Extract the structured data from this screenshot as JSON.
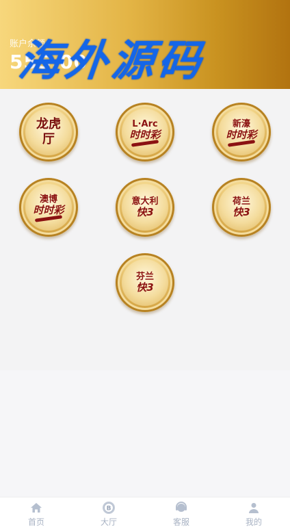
{
  "header": {
    "balance_label": "账户余额",
    "balance_value": "555.00",
    "watermark": "海外源码"
  },
  "games": [
    {
      "top": "龙虎",
      "bottom": "厅",
      "style": "single"
    },
    {
      "top": "L·Arc",
      "bottom": "时时彩",
      "style": "ssc"
    },
    {
      "top": "新濠",
      "bottom": "时时彩",
      "style": "ssc"
    },
    {
      "top": "澳博",
      "bottom": "时时彩",
      "style": "ssc"
    },
    {
      "top": "意大利",
      "bottom": "快3",
      "style": "k3"
    },
    {
      "top": "荷兰",
      "bottom": "快3",
      "style": "k3"
    },
    {
      "top": "芬兰",
      "bottom": "快3",
      "style": "k3"
    }
  ],
  "nav": [
    {
      "label": "首页",
      "icon": "home-icon"
    },
    {
      "label": "大厅",
      "icon": "coin-icon"
    },
    {
      "label": "客服",
      "icon": "support-icon"
    },
    {
      "label": "我的",
      "icon": "user-icon"
    }
  ],
  "colors": {
    "accent_gold": "#e3b445",
    "game_text": "#8b1212",
    "watermark": "#1466e8",
    "nav_text": "#a9b3c4"
  }
}
